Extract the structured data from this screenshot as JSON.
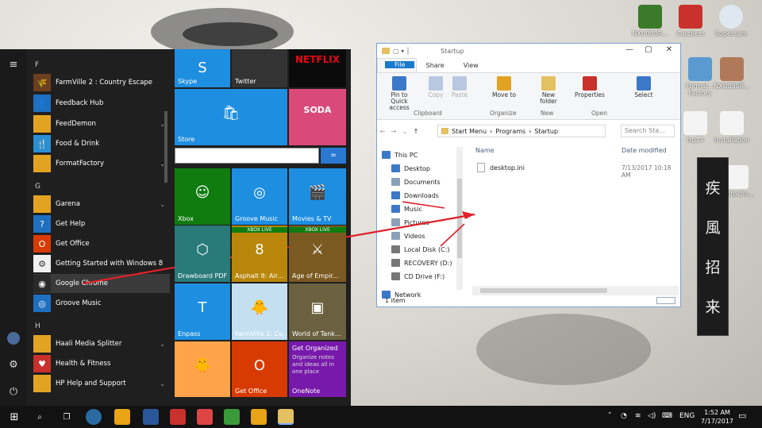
{
  "desktop": {
    "icons": [
      {
        "label": "NXU050R..."
      },
      {
        "label": "Catchers"
      },
      {
        "label": "Supercam"
      },
      {
        "label": "Format... Factory"
      },
      {
        "label": "NXU050R..."
      },
      {
        "label": "frp14"
      },
      {
        "label": "Installation"
      },
      {
        "label": "Photosho..."
      }
    ],
    "calligraphy": [
      "疾",
      "風",
      "招",
      "来"
    ]
  },
  "start_menu": {
    "letters": [
      "F",
      "G",
      "H"
    ],
    "apps": [
      {
        "label": "FarmVille 2 : Country Escape",
        "color": "#6b3f1f",
        "icon": "farm-icon"
      },
      {
        "label": "Feedback Hub",
        "color": "#1e6fbf",
        "icon": "person-icon"
      },
      {
        "label": "FeedDemon",
        "color": "#e3a322",
        "icon": "folder-icon",
        "expand": "⌄"
      },
      {
        "label": "Food & Drink",
        "color": "#2a8fd0",
        "icon": "cutlery-icon"
      },
      {
        "label": "FormatFactory",
        "color": "#e3a322",
        "icon": "folder-icon",
        "expand": "⌄"
      },
      {
        "label": "Garena",
        "color": "#e3a322",
        "icon": "folder-icon",
        "expand": "⌄"
      },
      {
        "label": "Get Help",
        "color": "#1e6fbf",
        "icon": "help-icon"
      },
      {
        "label": "Get Office",
        "color": "#d83b01",
        "icon": "office-icon"
      },
      {
        "label": "Getting Started with Windows 8",
        "color": "#f0f0f0",
        "icon": "gear-icon"
      },
      {
        "label": "Google Chrome",
        "color": "#2a2a2a",
        "icon": "chrome-icon"
      },
      {
        "label": "Groove Music",
        "color": "#1e6fbf",
        "icon": "music-icon"
      },
      {
        "label": "Haali Media Splitter",
        "color": "#e3a322",
        "icon": "folder-icon",
        "expand": "⌄"
      },
      {
        "label": "Health & Fitness",
        "color": "#c8312c",
        "icon": "heart-icon"
      },
      {
        "label": "HP Help and Support",
        "color": "#e3a322",
        "icon": "folder-icon",
        "expand": "⌄"
      }
    ],
    "tiles": [
      {
        "label": "Skype",
        "color": "#1e8ee0",
        "glyph": "S"
      },
      {
        "label": "Twitter",
        "color": "#333333",
        "glyph": ""
      },
      {
        "label": "NETFLIX",
        "color": "#0b0b0b",
        "glyph": ""
      },
      {
        "label": "Store",
        "color": "#1e8ee0",
        "glyph": "🛍"
      },
      {
        "label": "",
        "color": "#d94a7a",
        "glyph": "SODA"
      },
      {
        "label": "Xbox",
        "color": "#107c10",
        "glyph": "☺"
      },
      {
        "label": "Groove Music",
        "color": "#1e8ee0",
        "glyph": "◎"
      },
      {
        "label": "Movies & TV",
        "color": "#1e8ee0",
        "glyph": "🎬"
      },
      {
        "label": "Drawboard PDF",
        "color": "#2a7a7a",
        "glyph": "⬡"
      },
      {
        "label": "Asphalt 8: Air...",
        "color": "#b8860b",
        "glyph": "8"
      },
      {
        "label": "Age of Empir...",
        "color": "#7a5a20",
        "glyph": "⚔"
      },
      {
        "label": "Enpass",
        "color": "#1e8ee0",
        "glyph": "T"
      },
      {
        "label": "FarmVille 2: Co...",
        "color": "#c4e0f0",
        "glyph": "🐥"
      },
      {
        "label": "World of Tank...",
        "color": "#6b6040",
        "glyph": "▣"
      },
      {
        "label": "",
        "color": "#ffa34a",
        "glyph": "🐥"
      },
      {
        "label": "Get Office",
        "color": "#d83b01",
        "glyph": "O"
      },
      {
        "label": "OneNote",
        "color": "#7719aa",
        "glyph": ""
      }
    ],
    "onenote_text": {
      "title": "Get Organized",
      "body": "Organize notes and ideas all in one place"
    },
    "netflix": "NETFLIX",
    "xbox_live": "XBOX LIVE"
  },
  "explorer": {
    "title": "Startup",
    "tabs": [
      "File",
      "Home",
      "Share",
      "View"
    ],
    "ribbon": [
      {
        "label": "Pin to Quick access",
        "dim": false,
        "color": "#3b78c8"
      },
      {
        "label": "Copy",
        "dim": true,
        "color": "#b8c8e0"
      },
      {
        "label": "Paste",
        "dim": true,
        "color": "#b8c8e0"
      },
      {
        "label": "Move to",
        "dim": false,
        "color": "#e3a322"
      },
      {
        "label": "New folder",
        "dim": false,
        "color": "#e3c060"
      },
      {
        "label": "Properties",
        "dim": false,
        "color": "#c8312c"
      },
      {
        "label": "Select",
        "dim": false,
        "color": "#3b78c8"
      }
    ],
    "groups": [
      "Clipboard",
      "Organize",
      "New",
      "Open"
    ],
    "breadcrumb": [
      "Start Menu",
      "Programs",
      "Startup"
    ],
    "search_placeholder": "Search Sta...",
    "nav_items": [
      {
        "label": "This PC",
        "color": "#3b78c8"
      },
      {
        "label": "Desktop",
        "color": "#3b78c8"
      },
      {
        "label": "Documents",
        "color": "#8aa0b8"
      },
      {
        "label": "Downloads",
        "color": "#3b78c8"
      },
      {
        "label": "Music",
        "color": "#3b78c8"
      },
      {
        "label": "Pictures",
        "color": "#8aa0b8"
      },
      {
        "label": "Videos",
        "color": "#8aa0b8"
      },
      {
        "label": "Local Disk (C:)",
        "color": "#777777"
      },
      {
        "label": "RECOVERY (D:)",
        "color": "#777777"
      },
      {
        "label": "CD Drive (F:)",
        "color": "#777777"
      },
      {
        "label": "Network",
        "color": "#3b78c8"
      }
    ],
    "columns": {
      "name": "Name",
      "date": "Date modified"
    },
    "files": [
      {
        "name": "desktop.ini",
        "date": "7/13/2017 10:18 AM"
      }
    ],
    "status": "1 item"
  },
  "taskbar": {
    "pinned": [
      {
        "name": "chrome",
        "color": "#e8a317"
      },
      {
        "name": "word",
        "color": "#2b579a"
      },
      {
        "name": "tiles",
        "color": "#c8312c"
      },
      {
        "name": "itunes",
        "color": "#d44"
      },
      {
        "name": "cheat",
        "color": "#3a9a3a"
      },
      {
        "name": "paint",
        "color": "#e8a317"
      },
      {
        "name": "explorer",
        "color": "#e3c060"
      }
    ],
    "lang": "ENG",
    "time": "1:52 AM",
    "date": "7/17/2017"
  },
  "colors": {
    "accent": "#1e8ee0",
    "arrow": "#e0202a"
  }
}
